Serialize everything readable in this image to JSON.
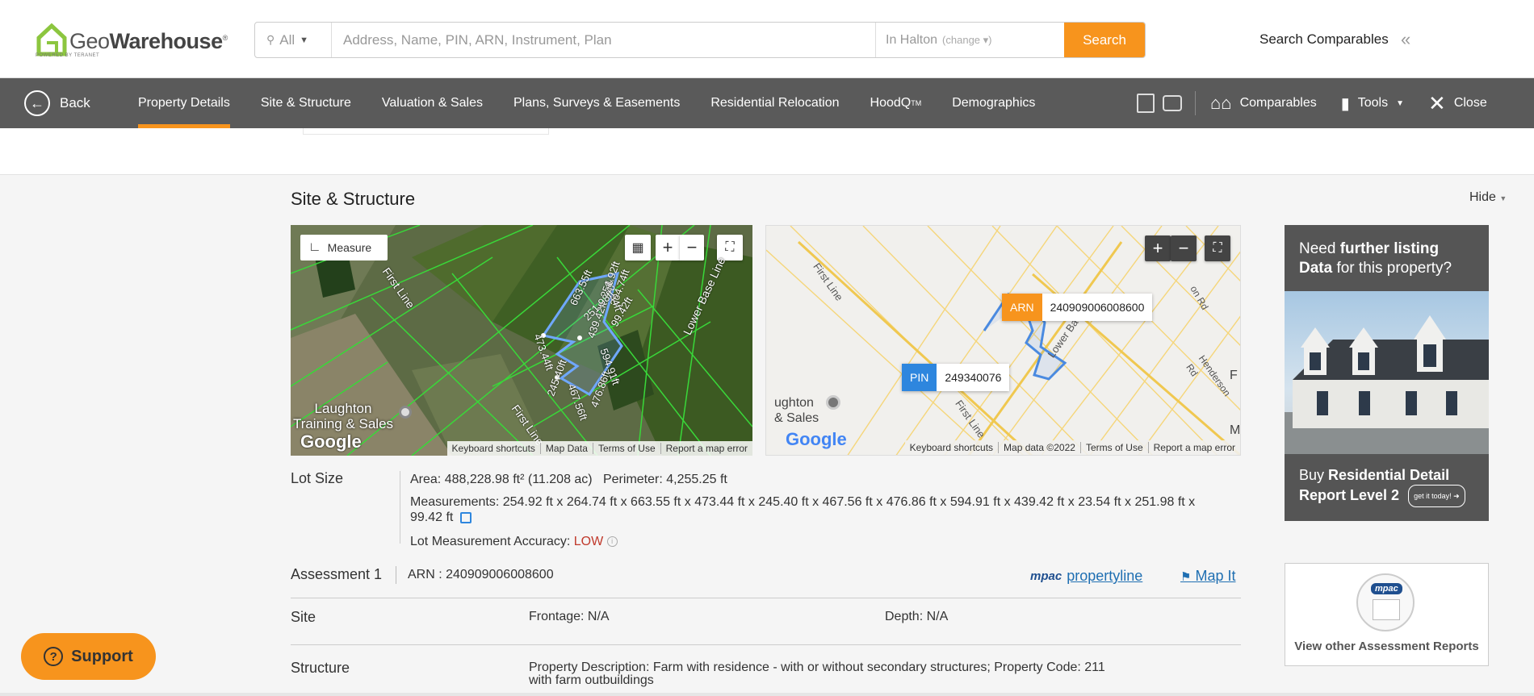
{
  "brand": {
    "name_light": "Geo",
    "name_bold": "Warehouse",
    "reg": "®",
    "powered": "POWERED BY TERANET"
  },
  "search": {
    "scope": "All",
    "placeholder": "Address, Name, PIN, ARN, Instrument, Plan",
    "location": "In Halton",
    "change": "(change ▾)",
    "button": "Search"
  },
  "header": {
    "search_comparables": "Search Comparables"
  },
  "nav": {
    "back": "Back",
    "tabs": [
      {
        "label": "Property Details",
        "active": true
      },
      {
        "label": "Site & Structure"
      },
      {
        "label": "Valuation & Sales"
      },
      {
        "label": "Plans, Surveys & Easements"
      },
      {
        "label": "Residential Relocation"
      },
      {
        "label": "HoodQ",
        "sup": "TM"
      },
      {
        "label": "Demographics"
      }
    ],
    "comparables": "Comparables",
    "tools": "Tools",
    "close": "Close"
  },
  "section": {
    "title": "Site & Structure",
    "hide": "Hide"
  },
  "map_satellite": {
    "measure": "Measure",
    "labels": [
      "663.55ft",
      "254.92ft",
      "264.74ft",
      "473.44ft",
      "245.40ft",
      "467.56ft",
      "476.86ft",
      "594.91ft",
      "439.42ft",
      "23.54ft",
      "251.98ft",
      "99.42ft"
    ],
    "roads": [
      "First Line",
      "First Line",
      "Lower Base Line"
    ],
    "place": "Laughton\nTraining & Sales",
    "footer": [
      "Keyboard shortcuts",
      "Map Data",
      "Terms of Use",
      "Report a map error"
    ],
    "google": "Google"
  },
  "map_road": {
    "arn_key": "ARN",
    "arn_value": "240909006008600",
    "pin_key": "PIN",
    "pin_value": "249340076",
    "roads": [
      "First Line",
      "First Line",
      "Lower Ba",
      "Henderson Rd",
      "on Rd"
    ],
    "place": "ughton\n& Sales",
    "footer": [
      "Keyboard shortcuts",
      "Map data ©2022",
      "Terms of Use",
      "Report a map error"
    ],
    "google": "Google",
    "edge_letters": [
      "F",
      "M"
    ]
  },
  "promo": {
    "line1_a": "Need ",
    "line1_b": "further listing",
    "line2_a": "Data",
    "line2_b": " for this property?",
    "buy_a": "Buy ",
    "buy_b": "Residential Detail",
    "buy_c": "Report Level 2",
    "cta": "get it today!"
  },
  "assess_card": {
    "logo": "mpac",
    "caption": "View other Assessment Reports"
  },
  "lot": {
    "label": "Lot Size",
    "area_label": "Area:",
    "area_value": " 488,228.98 ft² (11.208 ac)",
    "perimeter_label": "Perimeter:",
    "perimeter_value": " 4,255.25 ft",
    "measurements_label": "Measurements:",
    "measurements_value": " 254.92 ft x 264.74 ft x 663.55 ft x 473.44 ft x 245.40 ft x 467.56 ft x 476.86 ft x 594.91 ft x 439.42 ft x 23.54 ft x 251.98 ft x",
    "measurements_tail": "99.42 ft",
    "accuracy_label": "Lot Measurement Accuracy:",
    "accuracy_value": "LOW"
  },
  "assessment": {
    "title": "Assessment 1",
    "arn": "ARN : 240909006008600",
    "mpac": "mpac",
    "propertyline": "propertyline",
    "mapit": "Map It"
  },
  "site": {
    "title": "Site",
    "frontage": "Frontage: N/A",
    "depth": "Depth: N/A"
  },
  "structure": {
    "title": "Structure",
    "desc_line1": "Property Description: Farm with residence - with or without secondary structures;  Property Code: 211",
    "desc_line2": "with farm outbuildings"
  },
  "support": {
    "label": "Support"
  },
  "colors": {
    "accent": "#f7941d",
    "nav_bg": "#5a5a5a",
    "link": "#1f6fb2",
    "low": "#c0392b",
    "pin": "#2e86de",
    "arn": "#f7941d"
  }
}
